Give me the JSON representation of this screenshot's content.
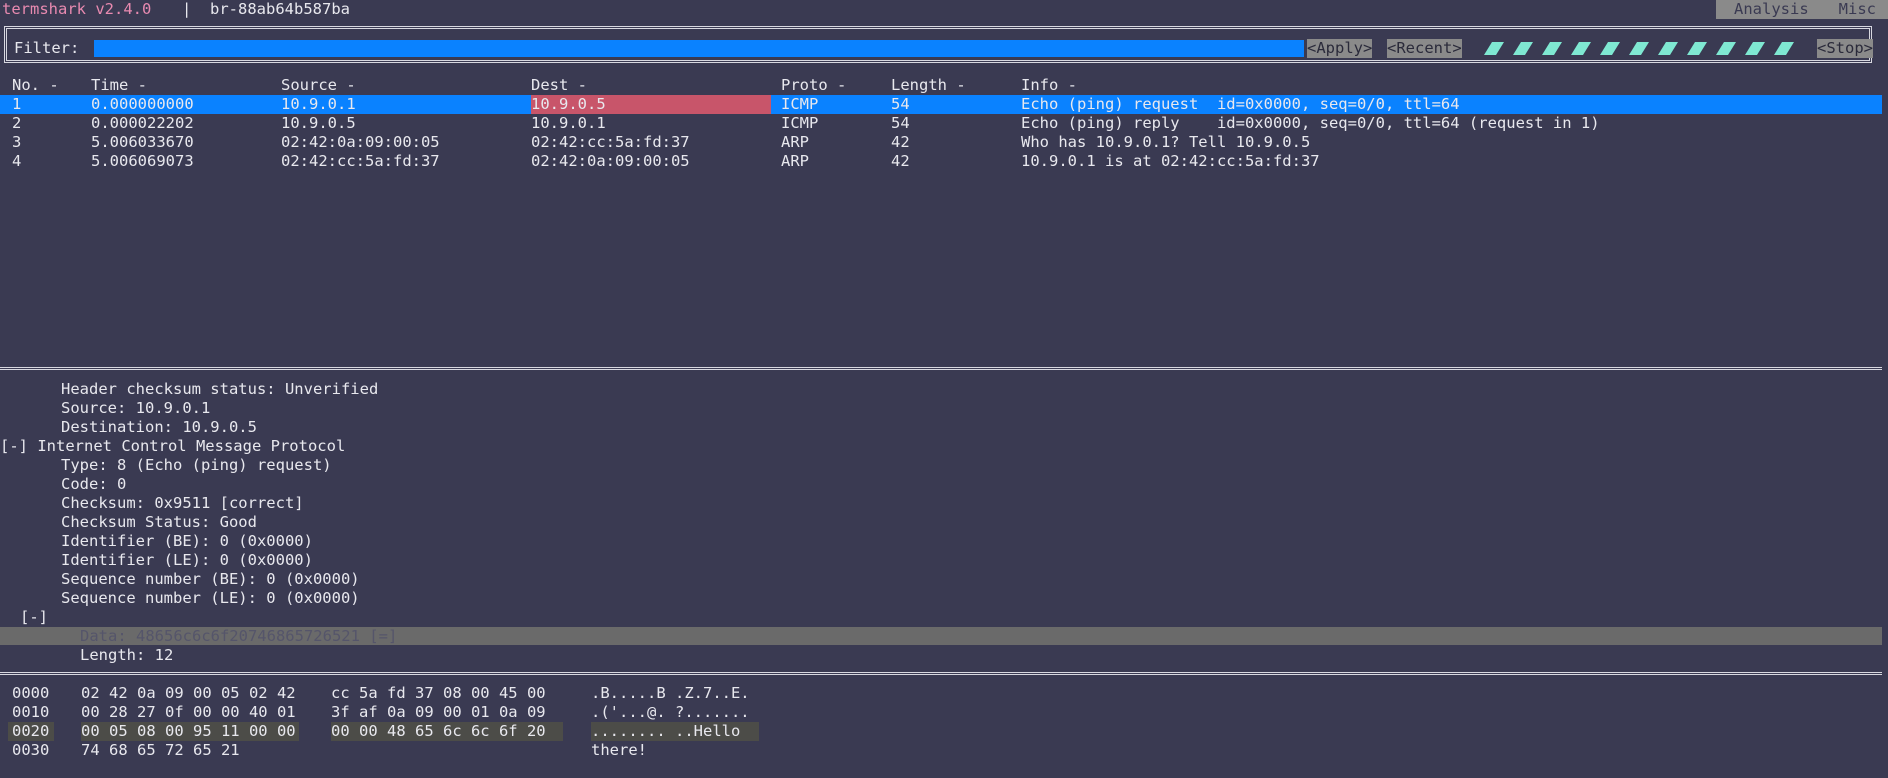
{
  "topbar": {
    "app_name": "termshark v2.4.0",
    "separator": "|",
    "interface": "br-88ab64b587ba",
    "menu": [
      "Analysis",
      "Misc"
    ]
  },
  "filter": {
    "label": "Filter:",
    "value": "",
    "apply": "<Apply>",
    "recent": "<Recent>",
    "stop": "<Stop>"
  },
  "columns": [
    "No. -",
    "Time -",
    "Source -",
    "Dest -",
    "Proto -",
    "Length -",
    "Info -"
  ],
  "packets": [
    {
      "no": "1",
      "time": "0.000000000",
      "src": "10.9.0.1",
      "dst": "10.9.0.5",
      "proto": "ICMP",
      "len": "54",
      "info": "Echo (ping) request  id=0x0000, seq=0/0, ttl=64"
    },
    {
      "no": "2",
      "time": "0.000022202",
      "src": "10.9.0.5",
      "dst": "10.9.0.1",
      "proto": "ICMP",
      "len": "54",
      "info": "Echo (ping) reply    id=0x0000, seq=0/0, ttl=64 (request in 1)"
    },
    {
      "no": "3",
      "time": "5.006033670",
      "src": "02:42:0a:09:00:05",
      "dst": "02:42:cc:5a:fd:37",
      "proto": "ARP",
      "len": "42",
      "info": "Who has 10.9.0.1? Tell 10.9.0.5"
    },
    {
      "no": "4",
      "time": "5.006069073",
      "src": "02:42:cc:5a:fd:37",
      "dst": "02:42:0a:09:00:05",
      "proto": "ARP",
      "len": "42",
      "info": "10.9.0.1 is at 02:42:cc:5a:fd:37"
    }
  ],
  "details": [
    "Header checksum status: Unverified",
    "Source: 10.9.0.1",
    "Destination: 10.9.0.5",
    "[-] Internet Control Message Protocol",
    "Type: 8 (Echo (ping) request)",
    "Code: 0",
    "Checksum: 0x9511 [correct]",
    "Checksum Status: Good",
    "Identifier (BE): 0 (0x0000)",
    "Identifier (LE): 0 (0x0000)",
    "Sequence number (BE): 0 (0x0000)",
    "Sequence number (LE): 0 (0x0000)",
    "[-]",
    "Data: 48656c6c6f20746865726521 [=]",
    "Length: 12"
  ],
  "hex": [
    {
      "off": "0000",
      "b1": "02 42 0a 09 00 05 02 42",
      "b2": "cc 5a fd 37 08 00 45 00",
      "asc": ".B.....B .Z.7..E."
    },
    {
      "off": "0010",
      "b1": "00 28 27 0f 00 00 40 01",
      "b2": "3f af 0a 09 00 01 0a 09",
      "asc": ".('...@. ?......."
    },
    {
      "off": "0020",
      "b1": "00 05 08 00 95 11 00 00",
      "b2": "00 00 48 65 6c 6c 6f 20",
      "asc": "........ ..Hello "
    },
    {
      "off": "0030",
      "b1": "74 68 65 72 65 21",
      "b2": "",
      "asc": "there!"
    }
  ]
}
